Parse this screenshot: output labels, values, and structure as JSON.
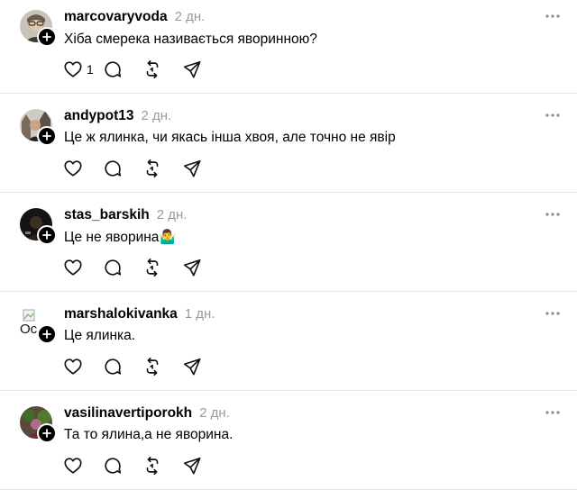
{
  "comments": [
    {
      "username": "marcovaryvoda",
      "time": "2 дн.",
      "text": "Хіба смерека називається яворинною?",
      "like_count": "1"
    },
    {
      "username": "andypot13",
      "time": "2 дн.",
      "text": "Це ж ялинка, чи якась інша хвоя, але точно не явір",
      "like_count": ""
    },
    {
      "username": "stas_barskih",
      "time": "2 дн.",
      "text": "Це не яворина🤷‍♂️",
      "like_count": ""
    },
    {
      "username": "marshalokivanka",
      "time": "1 дн.",
      "text": "Це ялинка.",
      "like_count": "",
      "avatar_alt": "Oc"
    },
    {
      "username": "vasilinavertiporokh",
      "time": "2 дн.",
      "text": "Та то ялина,а не яворина.",
      "like_count": ""
    }
  ],
  "colors": {
    "divider": "#e6e6e6",
    "muted": "#9a9a9a",
    "icon": "#111111"
  },
  "icons": [
    "heart-icon",
    "comment-icon",
    "repost-icon",
    "share-icon",
    "more-icon",
    "follow-plus-icon"
  ]
}
